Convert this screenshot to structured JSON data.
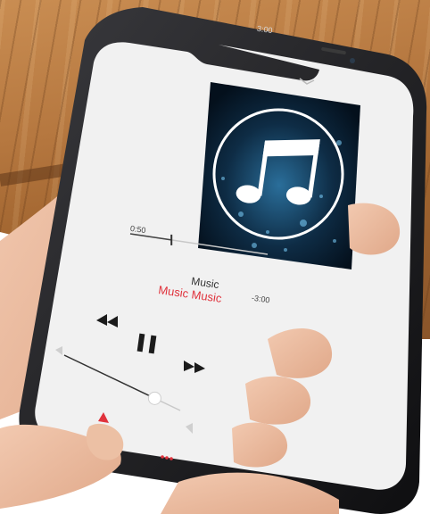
{
  "status_bar": {
    "time": "3:00"
  },
  "player": {
    "elapsed": "0:50",
    "remaining": "-3:00",
    "title": "Music",
    "artist": "Music Music",
    "progress": 0.3,
    "volume": 0.78
  },
  "icons": {
    "album_art": "music-note-icon",
    "rewind": "rewind-icon",
    "pause": "pause-icon",
    "forward": "fast-forward-icon",
    "collapse": "chevron-down-icon",
    "airplay": "airplay-icon",
    "more": "more-icon"
  },
  "colors": {
    "accent": "#e0323c",
    "screen": "#f1f1f1",
    "bezel": "#1b1b1d"
  }
}
